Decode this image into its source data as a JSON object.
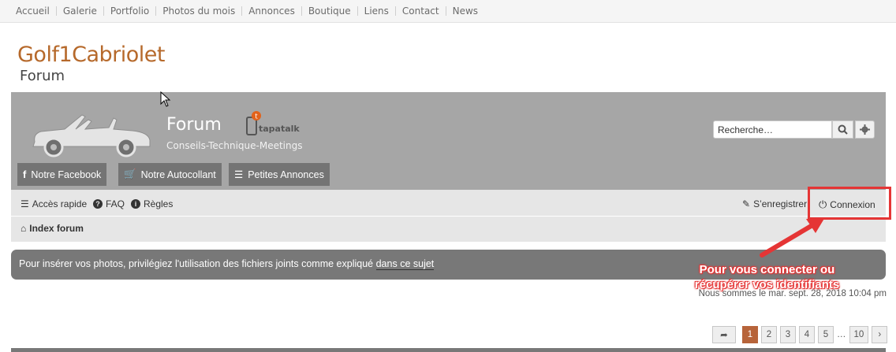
{
  "topnav": [
    "Accueil",
    "Galerie",
    "Portfolio",
    "Photos du mois",
    "Annonces",
    "Boutique",
    "Liens",
    "Contact",
    "News"
  ],
  "logo": {
    "title": "Golf1Cabriolet",
    "subtitle": "Forum"
  },
  "banner": {
    "title": "Forum",
    "description": "Conseils-Technique-Meetings",
    "tapatalk": "tapatalk",
    "search_placeholder": "Recherche…",
    "buttons": [
      {
        "label": "Notre Facebook",
        "icon": "facebook-icon"
      },
      {
        "label": "Notre Autocollant",
        "icon": "cart-icon"
      },
      {
        "label": "Petites Annonces",
        "icon": "list-icon"
      }
    ]
  },
  "navbar": {
    "quick_access": "Accès rapide",
    "faq": "FAQ",
    "rules": "Règles",
    "register": "S’enregistrer",
    "login": "Connexion",
    "breadcrumb": "Index forum"
  },
  "notice": {
    "text": "Pour insérer vos photos, privilégiez l'utilisation des fichiers joints comme expliqué ",
    "link": "dans ce sujet"
  },
  "datetime": "Nous sommes le mar. sept. 28, 2018 10:04 pm",
  "annotation": {
    "line1": "Pour vous connecter ou",
    "line2": "récupérer vos identifiants"
  },
  "pagination": {
    "pages": [
      "1",
      "2",
      "3",
      "4",
      "5"
    ],
    "ellipsis": "…",
    "last": "10",
    "current": "1"
  },
  "colors": {
    "accent": "#b6692b",
    "banner": "#a6a6a6",
    "highlight": "#e53535"
  }
}
